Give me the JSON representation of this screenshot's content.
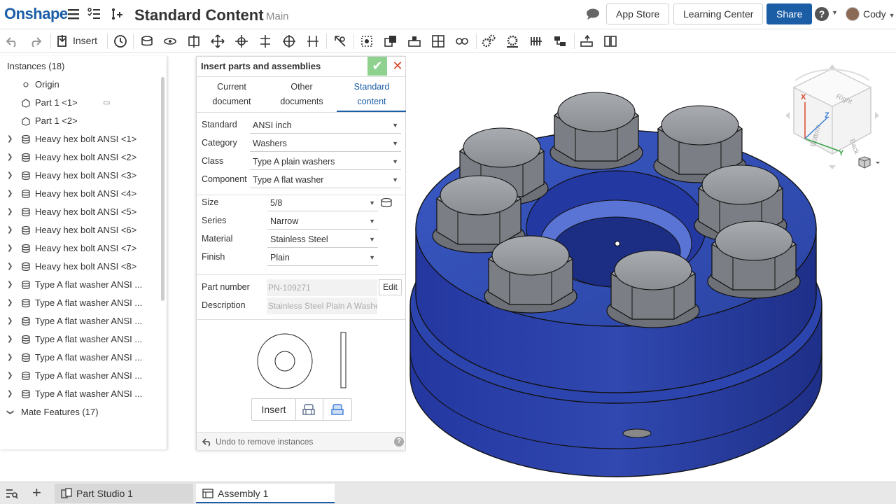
{
  "app": {
    "logo": "Onshape",
    "document_title": "Standard Content",
    "branch": "Main"
  },
  "header": {
    "app_store": "App Store",
    "learning_center": "Learning Center",
    "share": "Share",
    "help": "?",
    "user": "Cody"
  },
  "toolbar": {
    "insert_label": "Insert"
  },
  "instances": {
    "heading": "Instances (18)",
    "items": [
      {
        "label": "Origin",
        "icon": "origin-icon",
        "expandable": false
      },
      {
        "label": "Part 1 <1>",
        "icon": "part-icon",
        "expandable": false
      },
      {
        "label": "Part 1 <2>",
        "icon": "part-icon",
        "expandable": false
      },
      {
        "label": "Heavy hex bolt ANSI <1>",
        "icon": "standard-part-icon",
        "expandable": true
      },
      {
        "label": "Heavy hex bolt ANSI <2>",
        "icon": "standard-part-icon",
        "expandable": true
      },
      {
        "label": "Heavy hex bolt ANSI <3>",
        "icon": "standard-part-icon",
        "expandable": true
      },
      {
        "label": "Heavy hex bolt ANSI <4>",
        "icon": "standard-part-icon",
        "expandable": true
      },
      {
        "label": "Heavy hex bolt ANSI <5>",
        "icon": "standard-part-icon",
        "expandable": true
      },
      {
        "label": "Heavy hex bolt ANSI <6>",
        "icon": "standard-part-icon",
        "expandable": true
      },
      {
        "label": "Heavy hex bolt ANSI <7>",
        "icon": "standard-part-icon",
        "expandable": true
      },
      {
        "label": "Heavy hex bolt ANSI <8>",
        "icon": "standard-part-icon",
        "expandable": true
      },
      {
        "label": "Type A flat washer ANSI ...",
        "icon": "standard-part-icon",
        "expandable": true
      },
      {
        "label": "Type A flat washer ANSI ...",
        "icon": "standard-part-icon",
        "expandable": true
      },
      {
        "label": "Type A flat washer ANSI ...",
        "icon": "standard-part-icon",
        "expandable": true
      },
      {
        "label": "Type A flat washer ANSI ...",
        "icon": "standard-part-icon",
        "expandable": true
      },
      {
        "label": "Type A flat washer ANSI ...",
        "icon": "standard-part-icon",
        "expandable": true
      },
      {
        "label": "Type A flat washer ANSI ...",
        "icon": "standard-part-icon",
        "expandable": true
      },
      {
        "label": "Type A flat washer ANSI ...",
        "icon": "standard-part-icon",
        "expandable": true
      }
    ],
    "mate_features": "Mate Features (17)"
  },
  "dialog": {
    "title": "Insert parts and assemblies",
    "tabs": [
      {
        "line1": "Current",
        "line2": "document"
      },
      {
        "line1": "Other",
        "line2": "documents"
      },
      {
        "line1": "Standard",
        "line2": "content",
        "active": true
      }
    ],
    "fields1": [
      {
        "label": "Standard",
        "value": "ANSI inch"
      },
      {
        "label": "Category",
        "value": "Washers"
      },
      {
        "label": "Class",
        "value": "Type A plain washers"
      },
      {
        "label": "Component",
        "value": "Type A flat washer"
      }
    ],
    "fields2": [
      {
        "label": "Size",
        "value": "5/8"
      },
      {
        "label": "Series",
        "value": "Narrow"
      },
      {
        "label": "Material",
        "value": "Stainless Steel"
      },
      {
        "label": "Finish",
        "value": "Plain"
      }
    ],
    "part_number_label": "Part number",
    "part_number": "PN-109271",
    "edit": "Edit",
    "description_label": "Description",
    "description": "Stainless Steel Plain A Washe",
    "insert": "Insert",
    "undo": "Undo to remove instances"
  },
  "viewcube": {
    "x": "X",
    "y": "Y",
    "z": "Z",
    "right": "Right",
    "back": "Back",
    "bottom": "Bottom"
  },
  "bottom_tabs": {
    "part_studio": "Part Studio 1",
    "assembly": "Assembly 1"
  },
  "colors": {
    "brand": "#1b5ea6",
    "model_blue": "#2a45a8",
    "bolt_gray": "#8a8d92"
  }
}
